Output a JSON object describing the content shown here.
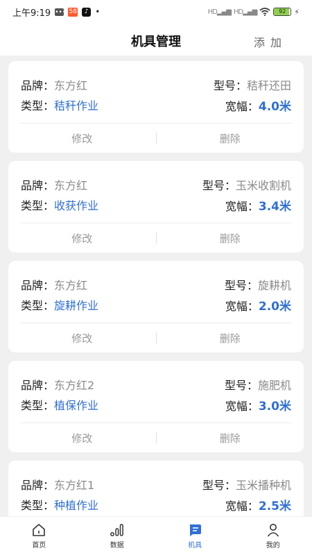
{
  "status_bar": {
    "time": "上午9:19",
    "app_badge": "58",
    "battery": "92",
    "battery_level": 0.92
  },
  "header": {
    "title": "机具管理",
    "add_label": "添加"
  },
  "labels": {
    "brand": "品牌：",
    "model": "型号：",
    "type": "类型：",
    "width": "宽幅：",
    "edit": "修改",
    "delete": "删除"
  },
  "machines": [
    {
      "brand": "东方红",
      "model": "秸秆还田",
      "type": "秸秆作业",
      "width": "4.0米"
    },
    {
      "brand": "东方红",
      "model": "玉米收割机",
      "type": "收获作业",
      "width": "3.4米"
    },
    {
      "brand": "东方红",
      "model": "旋耕机",
      "type": "旋耕作业",
      "width": "2.0米"
    },
    {
      "brand": "东方红2",
      "model": "施肥机",
      "type": "植保作业",
      "width": "3.0米"
    },
    {
      "brand": "东方红1",
      "model": "玉米播种机",
      "type": "种植作业",
      "width": "2.5米"
    }
  ],
  "tabbar": {
    "items": [
      {
        "label": "首页",
        "icon": "home-icon",
        "active": false
      },
      {
        "label": "数据",
        "icon": "bar-chart-icon",
        "active": false
      },
      {
        "label": "机具",
        "icon": "machine-icon",
        "active": true
      },
      {
        "label": "我的",
        "icon": "person-icon",
        "active": false
      }
    ]
  },
  "colors": {
    "accent": "#2f6fd6",
    "muted": "#8a8a8a",
    "background": "#f0f0f0"
  }
}
